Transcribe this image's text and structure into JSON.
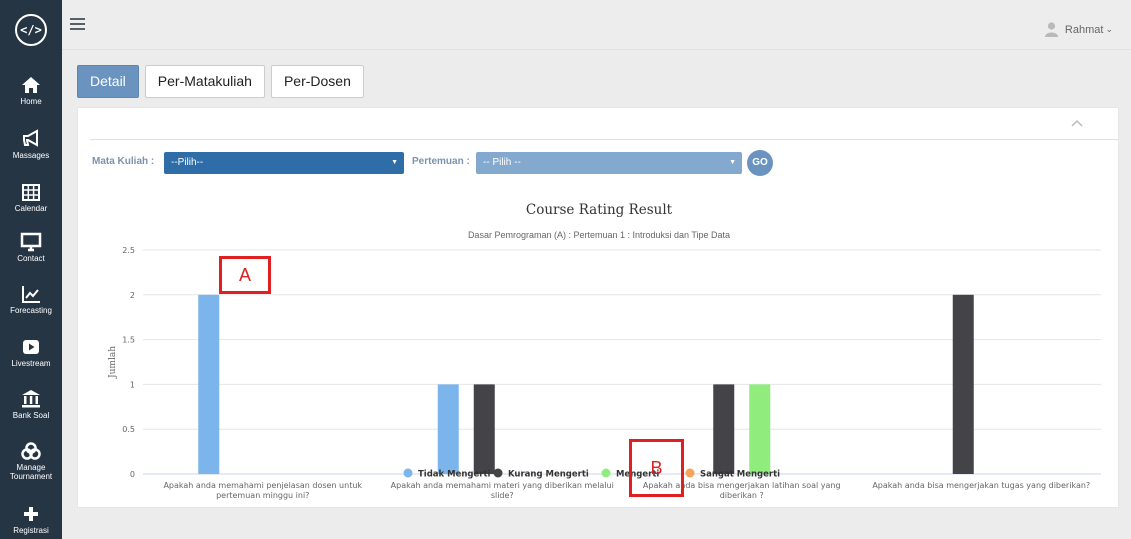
{
  "sidebar": {
    "logo": "</>",
    "items": [
      {
        "label": "Home",
        "icon": "home-icon"
      },
      {
        "label": "Massages",
        "icon": "megaphone-icon"
      },
      {
        "label": "Calendar",
        "icon": "calendar-icon"
      },
      {
        "label": "Contact",
        "icon": "monitor-icon"
      },
      {
        "label": "Forecasting",
        "icon": "chart-line-icon"
      },
      {
        "label": "Livestream",
        "icon": "play-icon"
      },
      {
        "label": "Bank Soal",
        "icon": "bank-icon"
      },
      {
        "label": "Manage Tournament",
        "icon": "biohazard-icon"
      },
      {
        "label": "Registrasi",
        "icon": "plus-icon"
      }
    ]
  },
  "topbar": {
    "user_name": "Rahmat",
    "user_caret": "⌄"
  },
  "tabs": [
    {
      "label": "Detail",
      "active": true
    },
    {
      "label": "Per-Matakuliah",
      "active": false
    },
    {
      "label": "Per-Dosen",
      "active": false
    }
  ],
  "filters": {
    "matakuliah_label": "Mata Kuliah :",
    "matakuliah_value": "--Pilih--",
    "pertemuan_label": "Pertemuan :",
    "pertemuan_value": "-- Pilih --",
    "go_label": "GO"
  },
  "annotations": {
    "a": "A",
    "b": "B"
  },
  "chart_data": {
    "type": "bar",
    "title": "Course Rating Result",
    "subtitle": "Dasar Pemrograman (A) : Pertemuan 1 : Introduksi dan Tipe Data",
    "ylabel": "Jumlah",
    "ylim": [
      0,
      2.5
    ],
    "yticks": [
      "0",
      "0.5",
      "1",
      "1.5",
      "2",
      "2.5"
    ],
    "grid": true,
    "legend_position": "bottom",
    "categories": [
      "Apakah anda memahami penjelasan dosen untuk pertemuan minggu ini?",
      "Apakah anda memahami materi yang diberikan melalui slide?",
      "Apakah anda bisa mengerjakan latihan soal yang diberikan ?",
      "Apakah anda bisa mengerjakan tugas yang diberikan?"
    ],
    "series": [
      {
        "name": "Tidak Mengerti",
        "color": "#7cb5ec",
        "values": [
          2,
          1,
          0,
          0
        ]
      },
      {
        "name": "Kurang Mengerti",
        "color": "#434348",
        "values": [
          0,
          1,
          1,
          2
        ]
      },
      {
        "name": "Mengerti",
        "color": "#90ed7d",
        "values": [
          0,
          0,
          1,
          0
        ]
      },
      {
        "name": "Sangat Mengerti",
        "color": "#f7a35c",
        "values": [
          0,
          0,
          0,
          0
        ]
      }
    ]
  }
}
